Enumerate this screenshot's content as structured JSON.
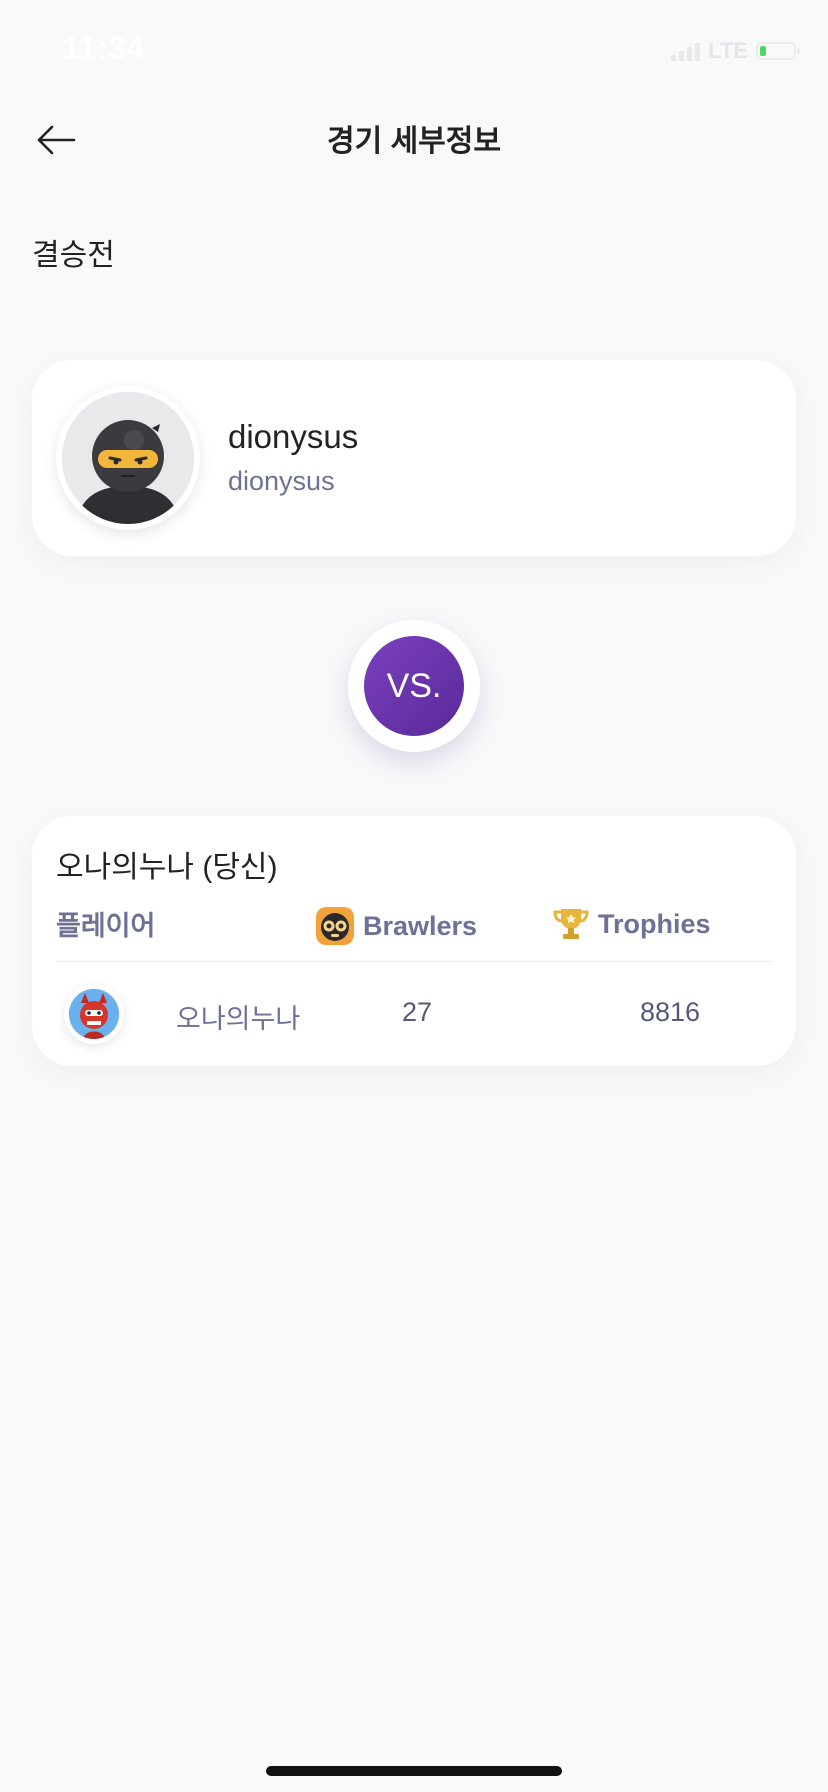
{
  "status_bar": {
    "time": "11:34",
    "network": "LTE",
    "battery_level": 0.2,
    "battery_color": "#4cd964"
  },
  "header": {
    "back_icon": "arrow-left-icon",
    "title": "경기 세부정보"
  },
  "match": {
    "round_label": "결승전",
    "vs_label": "VS."
  },
  "opponent": {
    "avatar_icon": "ninja-avatar-icon",
    "name": "dionysus",
    "tag": "dionysus"
  },
  "team": {
    "title": "오나의누나 (당신)",
    "columns": {
      "player": "플레이어",
      "brawlers": "Brawlers",
      "brawlers_icon": "brawler-skull-icon",
      "trophies": "Trophies",
      "trophies_icon": "trophy-icon"
    },
    "players": [
      {
        "avatar_icon": "red-demon-avatar-icon",
        "name": "오나의누나",
        "brawlers": "27",
        "trophies": "8816"
      }
    ]
  },
  "colors": {
    "accent_purple": "#6a35b0",
    "muted_text": "#6e7196",
    "background": "#f9f9f9"
  }
}
